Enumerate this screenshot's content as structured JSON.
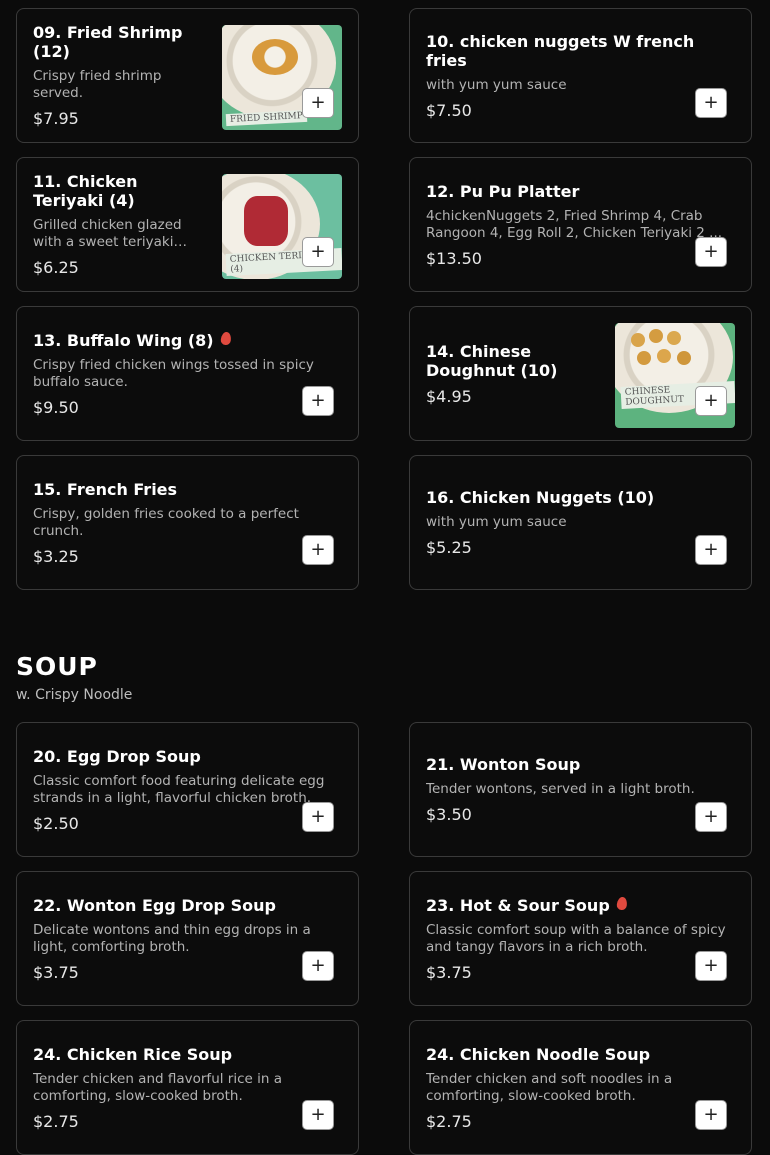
{
  "items_top": [
    {
      "name": "09. Fried Shrimp (12)",
      "desc": "Crispy fried shrimp served.",
      "price": "$7.95",
      "image": "fried-shrimp-photo",
      "image_text": "FRIED SHRIMP"
    },
    {
      "name": "10. chicken nuggets W french fries",
      "desc": "with yum yum sauce",
      "price": "$7.50"
    },
    {
      "name": "11. Chicken Teriyaki (4)",
      "desc": "Grilled chicken glazed with a sweet teriyaki sauce.",
      "price": "$6.25",
      "image": "chicken-teriyaki-photo",
      "image_text": "CHICKEN TERIYAKI (4)"
    },
    {
      "name": "12. Pu Pu Platter",
      "desc": "4chickenNuggets 2, Fried Shrimp 4, Crab Rangoon 4, Egg Roll 2, Chicken Teriyaki 2 ...",
      "price": "$13.50"
    },
    {
      "name": "13. Buffalo Wing (8)",
      "desc": "Crispy fried chicken wings tossed in spicy buffalo sauce.",
      "price": "$9.50",
      "spicy": true
    },
    {
      "name": "14. Chinese Doughnut (10)",
      "desc": "",
      "price": "$4.95",
      "image": "chinese-doughnut-photo",
      "image_text": "CHINESE DOUGHNUT"
    },
    {
      "name": "15. French Fries",
      "desc": "Crispy, golden fries cooked to a perfect crunch.",
      "price": "$3.25"
    },
    {
      "name": "16. Chicken Nuggets (10)",
      "desc": "with yum yum sauce",
      "price": "$5.25"
    }
  ],
  "soup": {
    "title": "SOUP",
    "subtitle": "w. Crispy Noodle",
    "items": [
      {
        "name": "20. Egg Drop Soup",
        "desc": "Classic comfort food featuring delicate egg strands in a light, flavorful chicken broth.",
        "price": "$2.50"
      },
      {
        "name": "21. Wonton Soup",
        "desc": "Tender wontons, served in a light broth.",
        "price": "$3.50"
      },
      {
        "name": "22. Wonton Egg Drop Soup",
        "desc": "Delicate wontons and thin egg drops in a light, comforting broth.",
        "price": "$3.75"
      },
      {
        "name": "23. Hot & Sour Soup",
        "desc": "Classic comfort soup with a balance of spicy and tangy flavors in a rich broth.",
        "price": "$3.75",
        "spicy": true
      },
      {
        "name": "24. Chicken Rice Soup",
        "desc": "Tender chicken and flavorful rice in a comforting, slow-cooked broth.",
        "price": "$2.75"
      },
      {
        "name": "24. Chicken Noodle Soup",
        "desc": "Tender chicken and soft noodles in a comforting, slow-cooked broth.",
        "price": "$2.75"
      }
    ]
  },
  "add_label": "+",
  "colors": {
    "background": "#0b0b0b",
    "card_border": "#3a3a3a",
    "spicy": "#e04a3f",
    "button_bg": "#ffffff"
  }
}
